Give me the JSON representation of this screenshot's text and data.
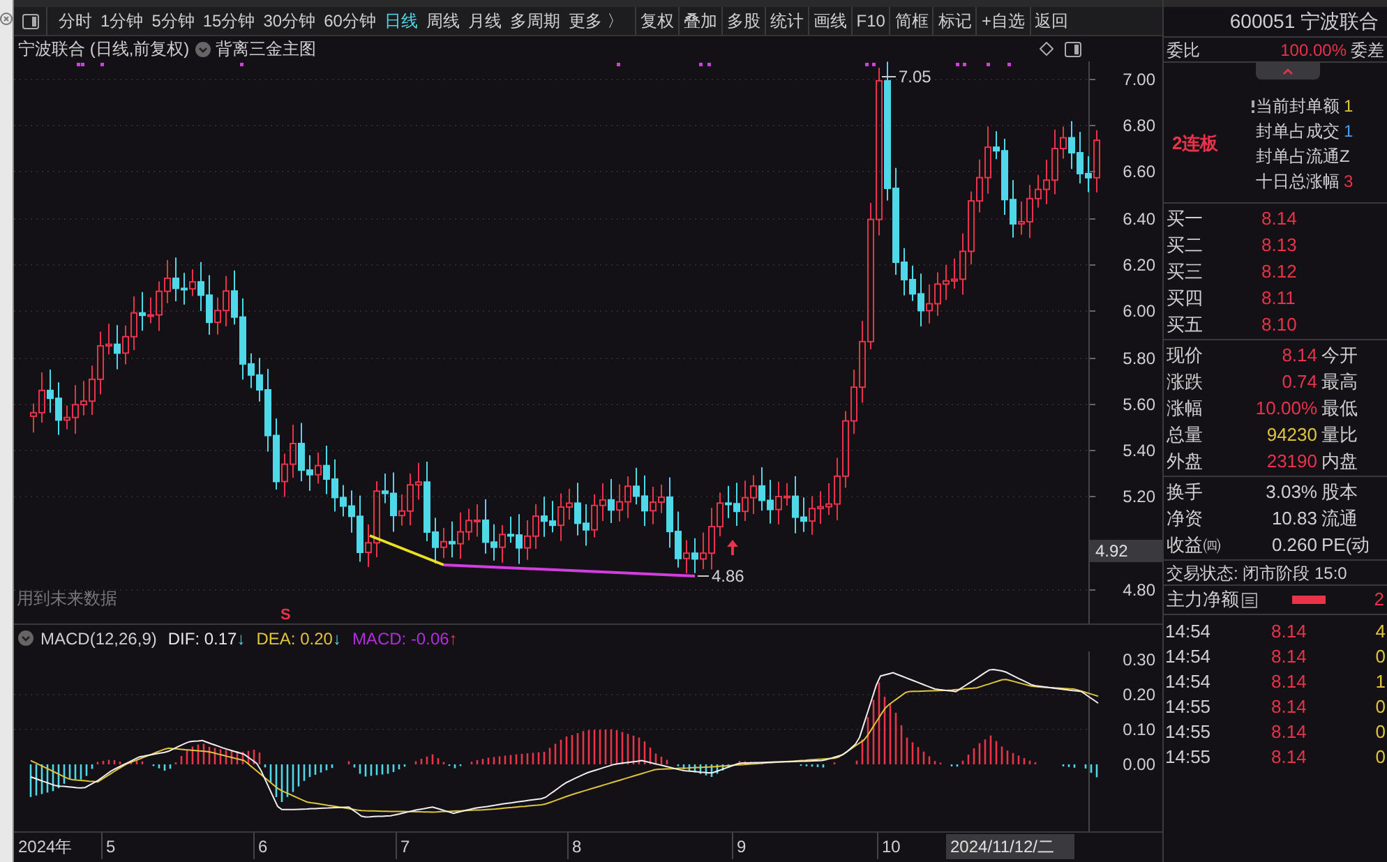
{
  "toolbar": {
    "periods": [
      {
        "label": "分时",
        "selected": false
      },
      {
        "label": "1分钟",
        "selected": false
      },
      {
        "label": "5分钟",
        "selected": false
      },
      {
        "label": "15分钟",
        "selected": false
      },
      {
        "label": "30分钟",
        "selected": false
      },
      {
        "label": "60分钟",
        "selected": false
      },
      {
        "label": "日线",
        "selected": true
      },
      {
        "label": "周线",
        "selected": false
      },
      {
        "label": "月线",
        "selected": false
      },
      {
        "label": "多周期",
        "selected": false
      },
      {
        "label": "更多 〉",
        "selected": false
      }
    ],
    "tools": [
      "复权",
      "叠加",
      "多股",
      "统计",
      "画线",
      "F10",
      "简框",
      "标记",
      "+自选",
      "返回"
    ]
  },
  "chart": {
    "title": "宁波联合 (日线,前复权)",
    "indicator": "背离三金主图",
    "price_ticks": [
      "7.00",
      "6.80",
      "6.60",
      "6.40",
      "6.20",
      "6.00",
      "5.80",
      "5.60",
      "5.40",
      "5.20",
      "4.80"
    ],
    "cursor_price": "4.92",
    "high_label": "7.05",
    "low_label": "4.86",
    "note": "用到未来数据",
    "signal_mark": "S"
  },
  "macd": {
    "name": "MACD(12,26,9)",
    "lines": [
      {
        "label": "DIF: 0.17",
        "arrow": "↓",
        "color": "#e8e8e8",
        "rising": false
      },
      {
        "label": "DEA: 0.20",
        "arrow": "↓",
        "color": "#e0c43c",
        "rising": false
      },
      {
        "label": "MACD: -0.06",
        "arrow": "↑",
        "color": "#b02ee0",
        "rising": true
      }
    ],
    "ticks": [
      "0.30",
      "0.20",
      "0.10",
      "0.00"
    ]
  },
  "date_axis": {
    "year": "2024年",
    "months": [
      "5",
      "6",
      "7",
      "8",
      "9",
      "10"
    ],
    "cursor_date": "2024/11/12/二"
  },
  "quote": {
    "code": "600051 宁波联合",
    "ratio": {
      "label": "委比",
      "value": "100.00%",
      "extra": "委差"
    },
    "limit": {
      "streak": "2连板",
      "rows": [
        {
          "label": "当前封单额",
          "value": "1",
          "color": "#e0c43c"
        },
        {
          "label": "封单占成交",
          "value": "1",
          "color": "#4a9cf0"
        },
        {
          "label": "封单占流通Z"
        },
        {
          "label": "十日总涨幅",
          "value": "3",
          "color": "#e8334a"
        }
      ]
    },
    "bids": [
      {
        "label": "买一",
        "price": "8.14"
      },
      {
        "label": "买二",
        "price": "8.13"
      },
      {
        "label": "买三",
        "price": "8.12"
      },
      {
        "label": "买四",
        "price": "8.11"
      },
      {
        "label": "买五",
        "price": "8.10"
      }
    ],
    "stats": [
      [
        {
          "label": "现价",
          "value": "8.14",
          "color": "#e8334a",
          "extra": "今开"
        },
        {
          "label": "涨跌",
          "value": "0.74",
          "color": "#e8334a",
          "extra": "最高"
        },
        {
          "label": "涨幅",
          "value": "10.00%",
          "color": "#e8334a",
          "extra": "最低"
        },
        {
          "label": "总量",
          "value": "94230",
          "color": "#e0c43c",
          "extra": "量比"
        },
        {
          "label": "外盘",
          "value": "23190",
          "color": "#e8334a",
          "extra": "内盘"
        }
      ],
      [
        {
          "label": "换手",
          "value": "3.03%",
          "color": "#d0d0d0",
          "extra": "股本"
        },
        {
          "label": "净资",
          "value": "10.83",
          "color": "#d0d0d0",
          "extra": "流通"
        },
        {
          "label": "收益㈣",
          "value": "0.260",
          "color": "#d0d0d0",
          "extra": "PE(动"
        }
      ]
    ],
    "status": "交易状态: 闭市阶段 15:0",
    "main_net": {
      "label": "主力净额",
      "value": "2"
    },
    "trades": [
      {
        "time": "14:54",
        "price": "8.14",
        "volume": "4"
      },
      {
        "time": "14:54",
        "price": "8.14",
        "volume": "0"
      },
      {
        "time": "14:54",
        "price": "8.14",
        "volume": "1"
      },
      {
        "time": "14:55",
        "price": "8.14",
        "volume": "0"
      },
      {
        "time": "14:55",
        "price": "8.14",
        "volume": "0"
      },
      {
        "time": "14:55",
        "price": "8.14",
        "volume": "0"
      }
    ]
  }
}
